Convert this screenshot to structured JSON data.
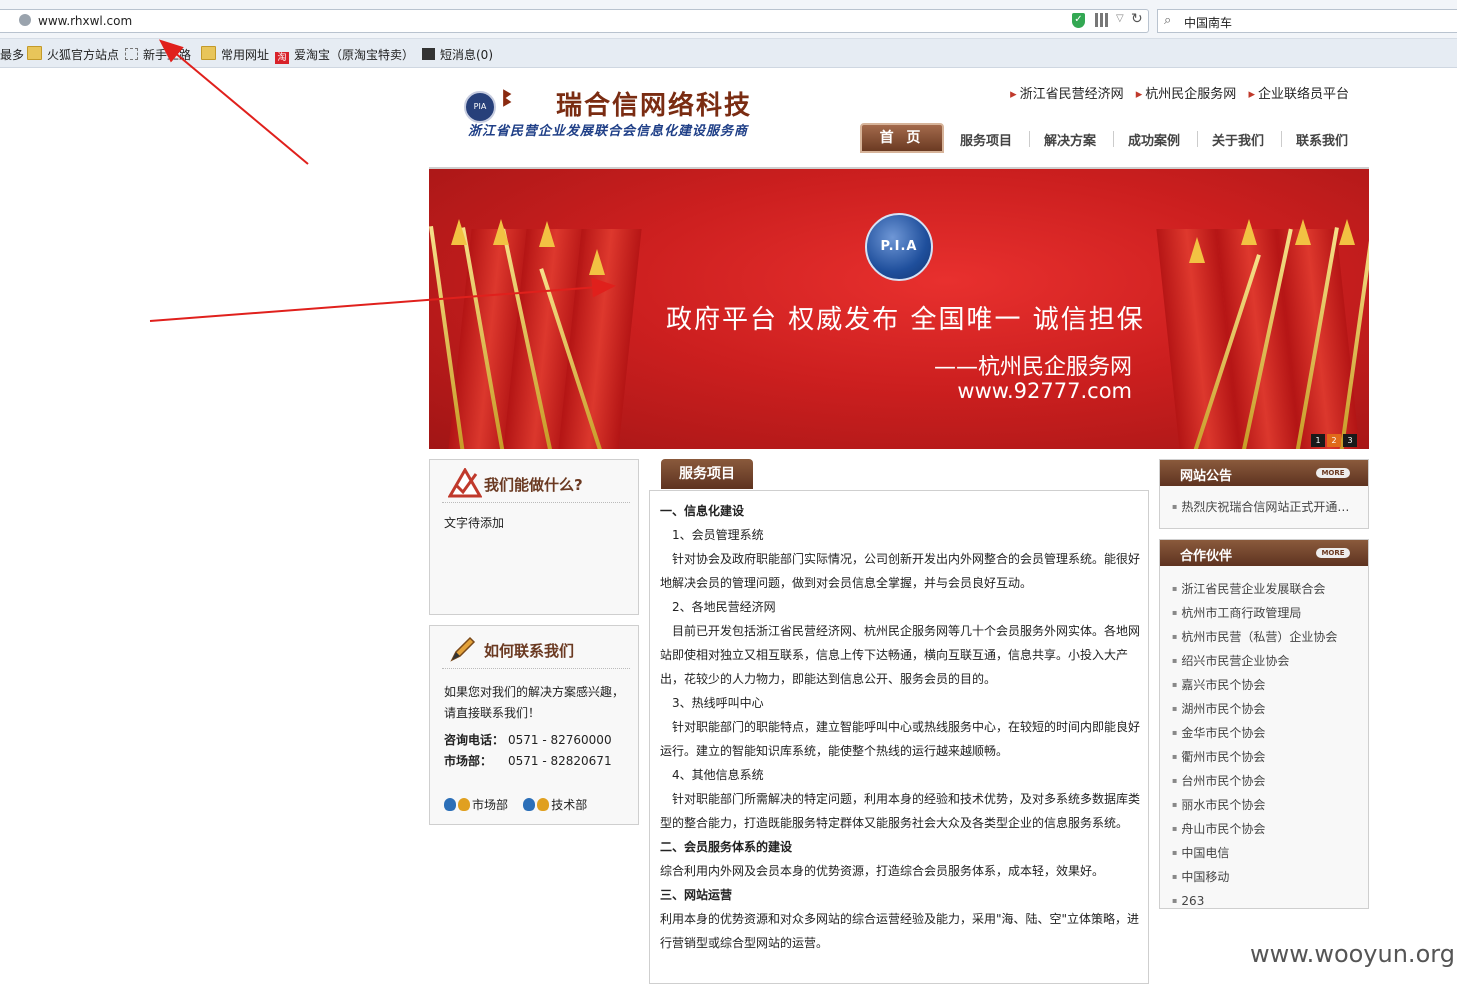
{
  "browser": {
    "url": "www.rhxwl.com",
    "search_value": "中国南车",
    "bookmarks": [
      "最多",
      "火狐官方站点",
      "新手上路",
      "常用网址",
      "爱淘宝（原淘宝特卖）",
      "短消息(0)"
    ]
  },
  "site": {
    "title": "瑞合信网络科技",
    "subtitle": "浙江省民营企业发展联合会信息化建设服务商",
    "top_links": [
      "浙江省民营经济网",
      "杭州民企服务网",
      "企业联络员平台"
    ],
    "nav": [
      "首 页",
      "服务项目",
      "解决方案",
      "成功案例",
      "关于我们",
      "联系我们"
    ]
  },
  "banner": {
    "badge": "P.I.A",
    "slogan": "政府平台  权威发布  全国唯一  诚信担保",
    "slogan_sub": "——杭州民企服务网",
    "slogan_url": "www.92777.com",
    "pager": [
      "1",
      "2",
      "3"
    ]
  },
  "left": {
    "what_title": "我们能做什么?",
    "what_text": "文字待添加",
    "contact_title": "如何联系我们",
    "contact_text": "如果您对我们的解决方案感兴趣，请直接联系我们！",
    "phone_label": "咨询电话：",
    "phone_value": "0571 - 82760000",
    "market_label": "市场部：",
    "market_value": "0571 - 82820671",
    "qq_market": "市场部",
    "qq_tech": "技术部"
  },
  "services": {
    "tab": "服务项目",
    "lines": [
      {
        "t": "一、信息化建设",
        "k": "h"
      },
      {
        "t": "1、会员管理系统",
        "k": "ind"
      },
      {
        "t": "针对协会及政府职能部门实际情况，公司创新开发出内外网整合的会员管理系统。能很好地解决会员的管理问题，做到对会员信息全掌握，并与会员良好互动。",
        "k": "p"
      },
      {
        "t": "2、各地民营经济网",
        "k": "ind"
      },
      {
        "t": "目前已开发包括浙江省民营经济网、杭州民企服务网等几十个会员服务外网实体。各地网站即使相对独立又相互联系，信息上传下达畅通，横向互联互通，信息共享。小投入大产出，花较少的人力物力，即能达到信息公开、服务会员的目的。",
        "k": "p"
      },
      {
        "t": "3、热线呼叫中心",
        "k": "ind"
      },
      {
        "t": "针对职能部门的职能特点，建立智能呼叫中心或热线服务中心，在较短的时间内即能良好运行。建立的智能知识库系统，能使整个热线的运行越来越顺畅。",
        "k": "p"
      },
      {
        "t": "4、其他信息系统",
        "k": "ind"
      },
      {
        "t": "针对职能部门所需解决的特定问题，利用本身的经验和技术优势，及对多系统多数据库类型的整合能力，打造既能服务特定群体又能服务社会大众及各类型企业的信息服务系统。",
        "k": "p"
      },
      {
        "t": "二、会员服务体系的建设",
        "k": "h"
      },
      {
        "t": "综合利用内外网及会员本身的优势资源，打造综合会员服务体系，成本轻，效果好。",
        "k": "n"
      },
      {
        "t": "三、网站运营",
        "k": "h"
      },
      {
        "t": "利用本身的优势资源和对众多网站的综合运营经验及能力，采用\"海、陆、空\"立体策略，进行营销型或综合型网站的运营。",
        "k": "n"
      }
    ]
  },
  "right": {
    "notice_title": "网站公告",
    "more": "MORE",
    "notice_item": "热烈庆祝瑞合信网站正式开通…",
    "partners_title": "合作伙伴",
    "partners": [
      "浙江省民营企业发展联合会",
      "杭州市工商行政管理局",
      "杭州市民营（私营）企业协会",
      "绍兴市民营企业协会",
      "嘉兴市民个协会",
      "湖州市民个协会",
      "金华市民个协会",
      "衢州市民个协会",
      "台州市民个协会",
      "丽水市民个协会",
      "舟山市民个协会",
      "中国电信",
      "中国移动",
      "263"
    ]
  },
  "watermark": "www.wooyun.org",
  "colors": {
    "brand_brown": "#6b3a22",
    "banner_red": "#cc1f1f",
    "arrow_red": "#e0201c"
  }
}
